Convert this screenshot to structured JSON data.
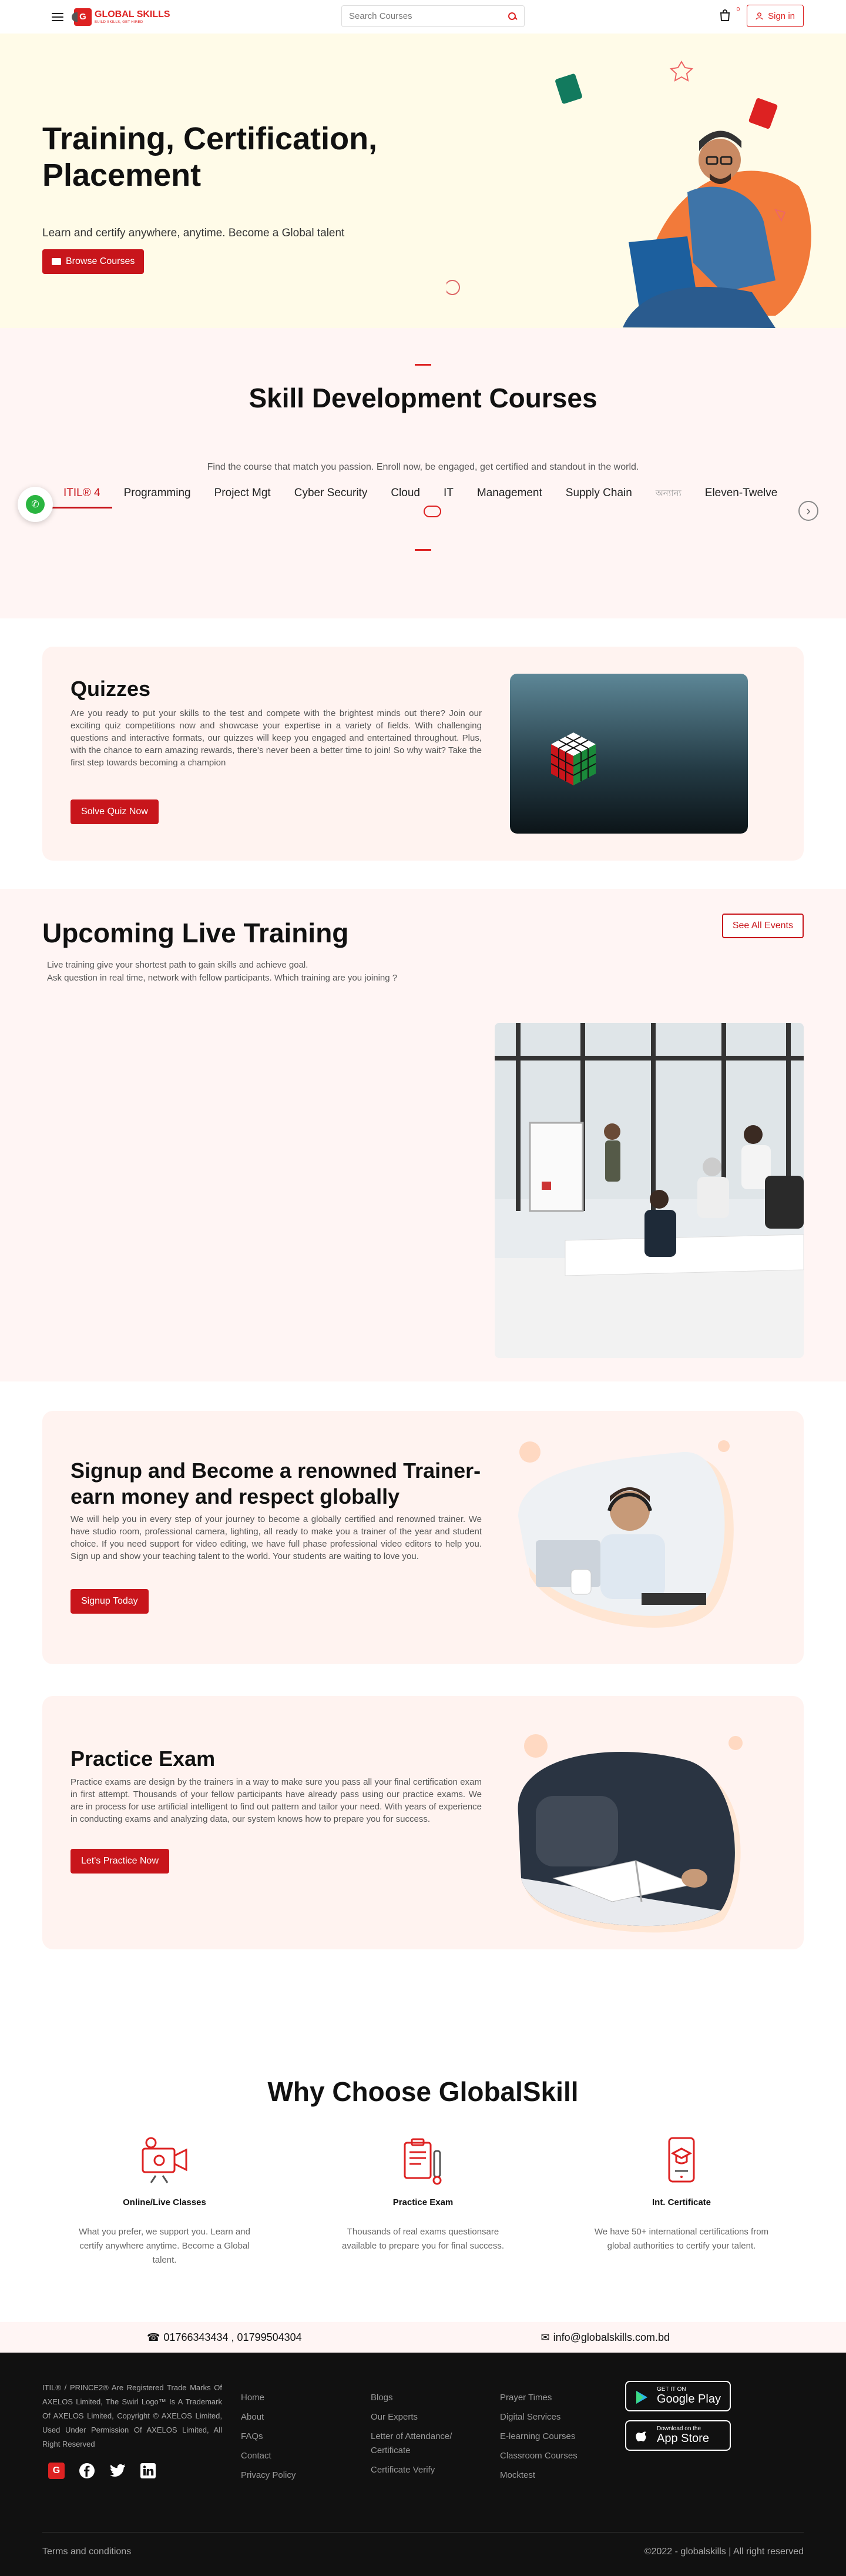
{
  "header": {
    "logo_title": "GLOBAL SKILLS",
    "logo_tag": "BUILD SKILLS, GET HIRED",
    "search_placeholder": "Search Courses",
    "cart_count": "0",
    "signin": "Sign in"
  },
  "hero": {
    "title": "Training, Certification, Placement",
    "subtitle": "Learn and certify anywhere, anytime. Become a Global talent",
    "cta": "Browse Courses"
  },
  "courses": {
    "title": "Skill Development Courses",
    "desc": "Find the course that match you passion. Enroll now, be engaged, get certified and standout in the world.",
    "tabs": [
      "ITIL® 4",
      "Programming",
      "Project Mgt",
      "Cyber Security",
      "Cloud",
      "IT",
      "Management",
      "Supply Chain",
      "অন্যান্য",
      "Eleven-Twelve"
    ],
    "active_tab": 0
  },
  "quizzes": {
    "title": "Quizzes",
    "text": "Are you ready to put your skills to the test and compete with the brightest minds out there? Join our exciting quiz competitions now and showcase your expertise in a variety of fields. With challenging questions and interactive formats, our quizzes will keep you engaged and entertained throughout. Plus, with the chance to earn amazing rewards, there's never been a better time to join! So why wait? Take the first step towards becoming a champion",
    "cta": "Solve Quiz Now"
  },
  "live": {
    "title": "Upcoming Live Training",
    "line1": "Live training give your shortest path to gain skills and achieve goal.",
    "line2": "Ask question in real time, network with fellow participants. Which training are you joining ?",
    "cta": "See All Events"
  },
  "trainer": {
    "title": "Signup and Become a renowned Trainer- earn money and respect globally",
    "text": "We will help you in every step of your journey to become a globally certified and renowned trainer. We have studio room, professional camera, lighting, all ready to make you a trainer of the year and student choice. If you need support for video editing, we have full phase professional video editors to help you. Sign up and show your teaching talent to the world. Your students are waiting to love you.",
    "cta": "Signup Today"
  },
  "practice": {
    "title": "Practice Exam",
    "text": "Practice exams are design by the trainers in a way to make sure you pass all your final certification exam in first attempt. Thousands of your fellow participants have already pass using our practice exams. We are in process for use artificial intelligent to find out pattern and tailor your need. With years of experience in conducting exams and analyzing data, our system knows how to prepare you for success.",
    "cta": "Let's Practice Now"
  },
  "why": {
    "title": "Why Choose GlobalSkill",
    "features": [
      {
        "title": "Online/Live Classes",
        "text": "What you prefer, we support you. Learn and certify anywhere anytime. Become a Global talent."
      },
      {
        "title": "Practice Exam",
        "text": "Thousands of real exams questionsare available to prepare you for final success."
      },
      {
        "title": "Int. Certificate",
        "text": "We have 50+ international certifications from global authorities to certify your talent."
      }
    ]
  },
  "contact": {
    "phone": "01766343434 , 01799504304",
    "email": "info@globalskills.com.bd"
  },
  "footer": {
    "legal": "ITIL® / PRINCE2® Are Registered Trade Marks Of AXELOS Limited, The Swirl Logo™ Is A Trademark Of AXELOS Limited, Copyright © AXELOS Limited, Used Under Permission Of AXELOS Limited, All Right Reserved",
    "col1": [
      "Home",
      "About",
      "FAQs",
      "Contact",
      "Privacy Policy"
    ],
    "col2": [
      "Blogs",
      "Our Experts",
      "Letter of Attendance/ Certificate",
      "Certificate Verify"
    ],
    "col3": [
      "Prayer Times",
      "Digital Services",
      "E-learning Courses",
      "Classroom Courses",
      "Mocktest"
    ],
    "google_small": "GET IT ON",
    "google_big": "Google Play",
    "apple_small": "Download on the",
    "apple_big": "App Store",
    "terms": "Terms and conditions",
    "copyright": "©2022 - globalskills | All right reserved"
  }
}
